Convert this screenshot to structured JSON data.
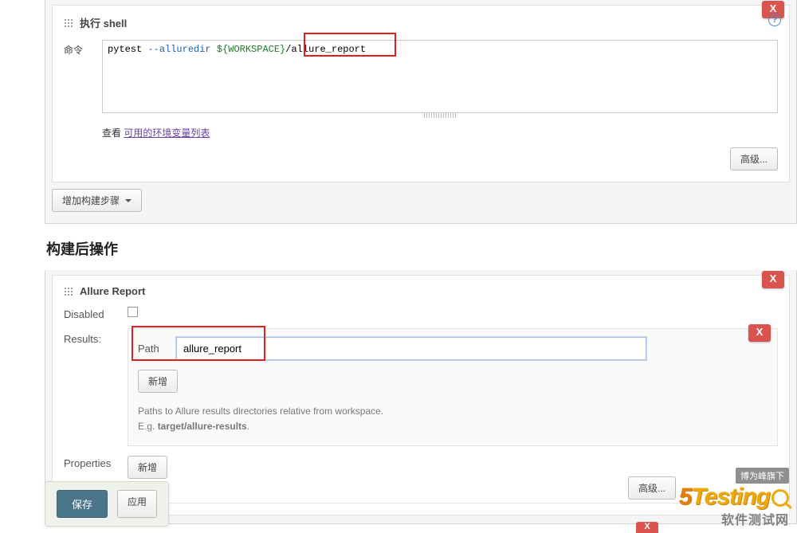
{
  "build_step": {
    "title": "执行 shell",
    "command_label": "命令",
    "command": {
      "base": "pytest ",
      "flag": "--alluredir ",
      "var": "${WORKSPACE}",
      "path": "/allure_report"
    },
    "env_prefix": "查看",
    "env_link": "可用的环境变量列表",
    "advanced": "高级...",
    "close": "X"
  },
  "add_step_button": "增加构建步骤",
  "post_build": {
    "heading": "构建后操作",
    "step_title": "Allure Report",
    "disabled_label": "Disabled",
    "results_label": "Results:",
    "path_label": "Path",
    "path_value": "allure_report",
    "add_button": "新增",
    "help_line1": "Paths to Allure results directories relative from workspace.",
    "help_line2_prefix": "E.g. ",
    "help_line2_bold": "target/allure-results",
    "properties_label": "Properties",
    "properties_button": "新增",
    "advanced": "高级...",
    "close": "X"
  },
  "footer": {
    "save": "保存",
    "apply": "应用"
  },
  "watermark": {
    "tag": "博为峰旗下",
    "logo_text": "Testing",
    "subtitle": "软件测试网"
  }
}
